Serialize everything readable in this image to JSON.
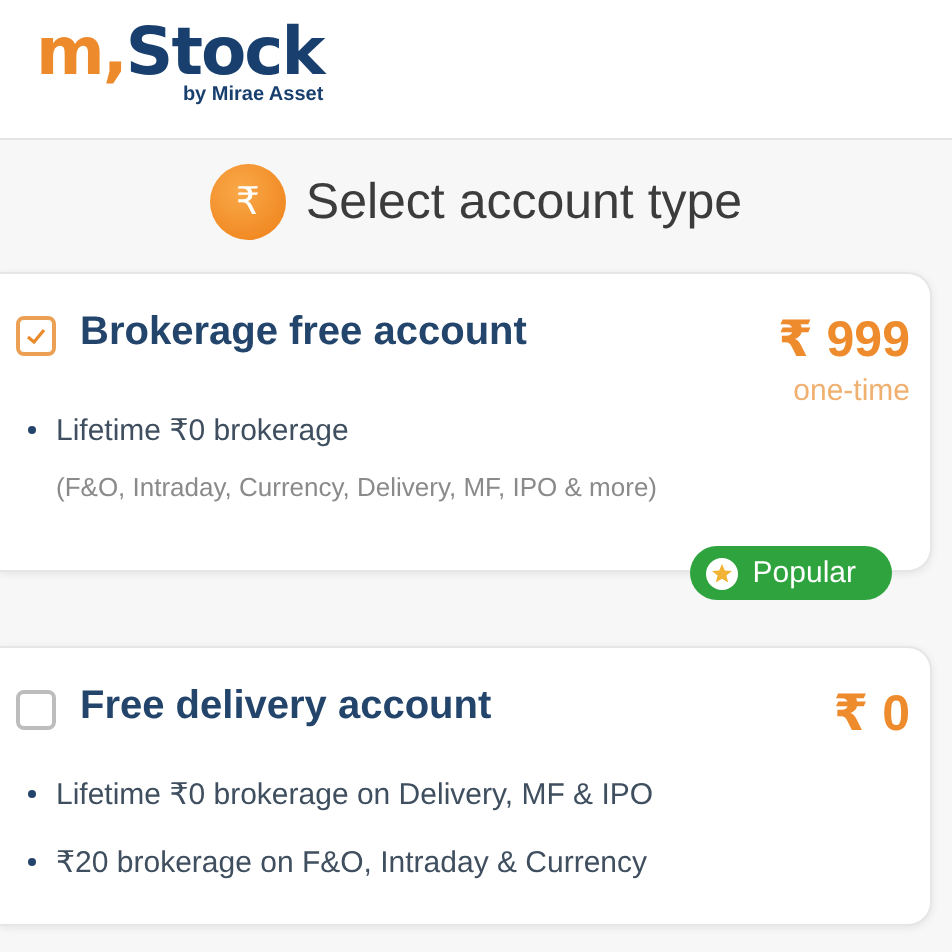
{
  "logo": {
    "prefix": "m,",
    "name": "Stock",
    "tagline": "by Mirae Asset"
  },
  "heading": {
    "icon_glyph": "₹",
    "title": "Select account type"
  },
  "accounts": [
    {
      "title": "Brokerage free account",
      "checked": true,
      "price": "₹ 999",
      "price_note": "one-time",
      "lines": [
        {
          "kind": "bullet",
          "text": "Lifetime ₹0 brokerage"
        },
        {
          "kind": "note",
          "text": "(F&O, Intraday, Currency, Delivery, MF, IPO & more)"
        }
      ],
      "badge": "Popular"
    },
    {
      "title": "Free delivery account",
      "checked": false,
      "price": "₹ 0",
      "lines": [
        {
          "kind": "bullet",
          "text": "Lifetime ₹0 brokerage on Delivery, MF & IPO"
        },
        {
          "kind": "bullet",
          "text": "₹20 brokerage on F&O, Intraday & Currency"
        }
      ]
    }
  ]
}
